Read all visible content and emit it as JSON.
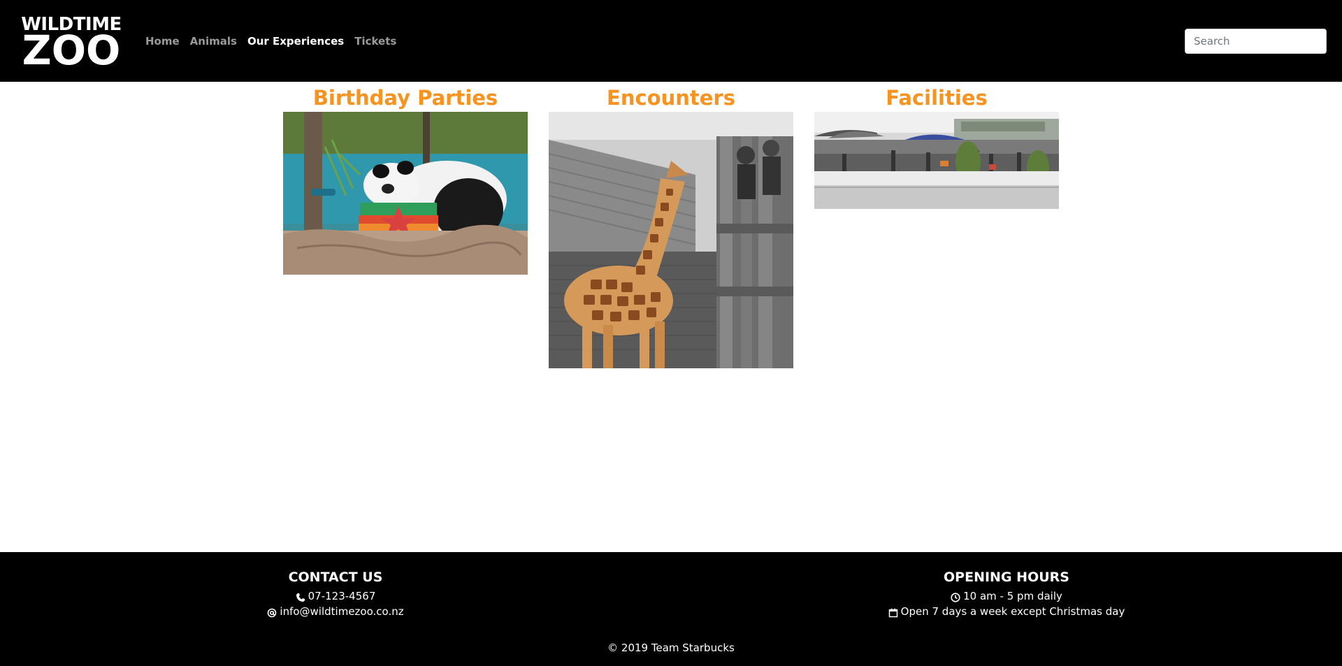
{
  "header": {
    "logo": {
      "line1": "WILDTIME",
      "line2": "ZOO"
    },
    "nav": [
      {
        "label": "Home",
        "active": false
      },
      {
        "label": "Animals",
        "active": false
      },
      {
        "label": "Our Experiences",
        "active": true
      },
      {
        "label": "Tickets",
        "active": false
      }
    ],
    "search": {
      "placeholder": "Search",
      "value": ""
    }
  },
  "main": {
    "cards": [
      {
        "title": "Birthday Parties",
        "image": "panda-with-birthday-cake"
      },
      {
        "title": "Encounters",
        "image": "giraffe-at-enclosure"
      },
      {
        "title": "Facilities",
        "image": "zoo-restaurant-terrace"
      }
    ]
  },
  "footer": {
    "contact": {
      "heading": "CONTACT US",
      "phone": "07-123-4567",
      "email": "info@wildtimezoo.co.nz"
    },
    "hours": {
      "heading": "OPENING HOURS",
      "time": "10 am - 5 pm daily",
      "days": "Open 7 days a week except Christmas day"
    },
    "copyright": "© 2019 Team Starbucks"
  },
  "colors": {
    "header_bg": "#000000",
    "accent": "#f7931e",
    "nav_inactive": "#9a9a9a",
    "nav_active": "#ffffff"
  }
}
